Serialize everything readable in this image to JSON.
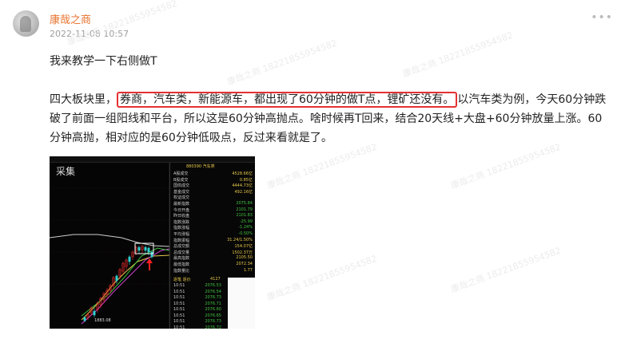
{
  "post": {
    "author": "康哉之商",
    "timestamp": "2022-11-08 10:57",
    "more_icon": "more-dots-icon",
    "line1": "我来教学一下右侧做T",
    "paragraph_before": "四大板块里，",
    "paragraph_highlight": "券商，汽车类，新能源车，都出现了60分钟的做T点，锂矿还没有。",
    "paragraph_after": "以汽车类为例，今天60分钟跌破了前面一组阳线和平台，所以这是60分钟高抛点。啥时候再T回来，结合20天线+大盘+60分钟放量上涨。60分钟高抛，相对应的是60分钟低吸点，反过来看就是了。",
    "highlight_color": "#e53131"
  },
  "watermark_text": "康哉之商 18221855954582",
  "chart_image": {
    "label": "采集",
    "title": "880390 汽车类",
    "low_label": "1883.08",
    "right_panel": [
      {
        "k": "A股成交",
        "v": "4528.66亿"
      },
      {
        "k": "B股成交",
        "v": "0.85亿"
      },
      {
        "k": "国债成交",
        "v": "4444.73亿"
      },
      {
        "k": "基金成交",
        "v": "492.16亿"
      },
      {
        "k": "权证成交",
        "v": ""
      },
      {
        "k": "最新指数",
        "v": "2075.84"
      },
      {
        "k": "今日开盘",
        "v": "2101.79"
      },
      {
        "k": "昨日收盘",
        "v": "2101.83"
      },
      {
        "k": "指数涨跌",
        "v": "-25.99"
      },
      {
        "k": "指数涨幅",
        "v": "-1.24%"
      },
      {
        "k": "平均涨幅",
        "v": "-0.50%"
      },
      {
        "k": "指数振幅",
        "v": "31.24/1.50%"
      },
      {
        "k": "总成交额",
        "v": "154.07亿"
      },
      {
        "k": "总成交量",
        "v": "1502.37万"
      },
      {
        "k": "最高指数",
        "v": "2105.50"
      },
      {
        "k": "最低指数",
        "v": "2072.34"
      },
      {
        "k": "指数量比",
        "v": "1.77"
      }
    ],
    "ticks": [
      {
        "t": "10:51",
        "v": "2076.53"
      },
      {
        "t": "10:51",
        "v": "2076.54"
      },
      {
        "t": "10:51",
        "v": "2076.73"
      },
      {
        "t": "10:51",
        "v": "2076.71"
      },
      {
        "t": "10:51",
        "v": "2076.60"
      },
      {
        "t": "10:51",
        "v": "2076.65"
      },
      {
        "t": "10:51",
        "v": "2076.73"
      },
      {
        "t": "10:51",
        "v": "2076.72"
      }
    ],
    "tick_header": "逐笔 逐价",
    "tick_count": "4127"
  }
}
